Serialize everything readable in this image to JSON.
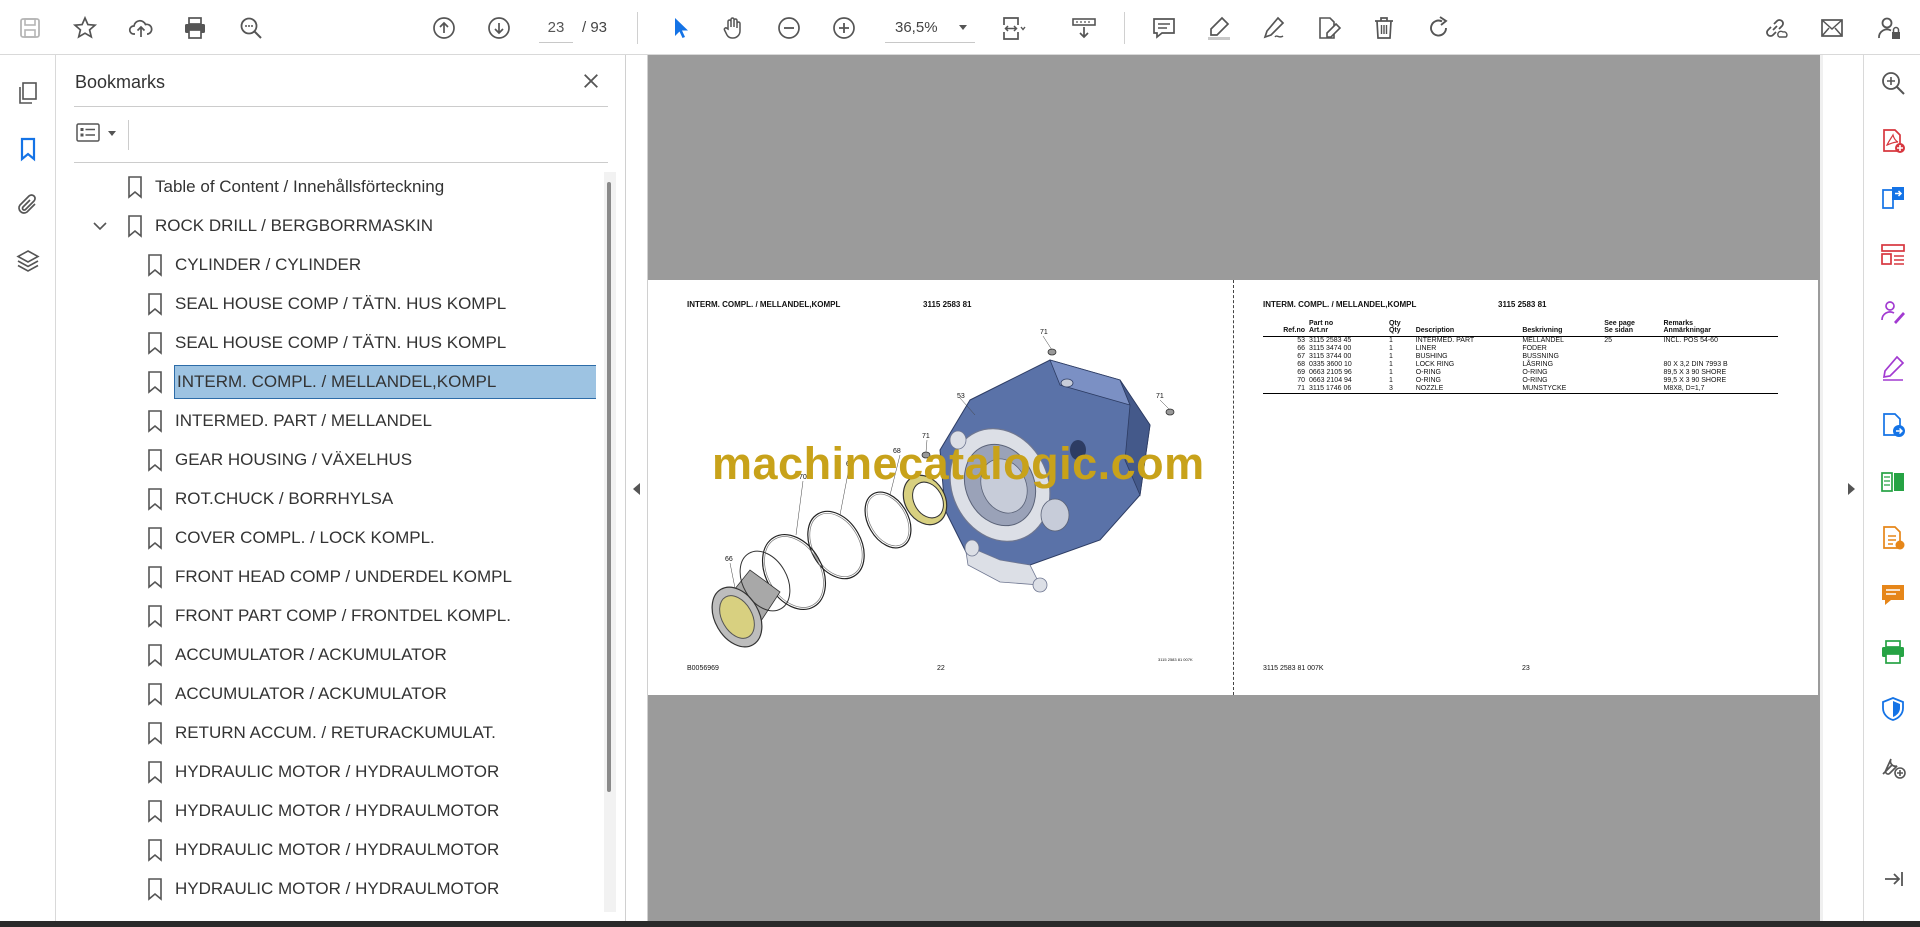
{
  "toolbar": {
    "current_page": "23",
    "total_pages": "/ 93",
    "zoom": "36,5%"
  },
  "bookmarks": {
    "title": "Bookmarks",
    "items": [
      {
        "label": "Table of Content / Innehållsförteckning",
        "level": 0
      },
      {
        "label": "ROCK DRILL / BERGBORRMASKIN",
        "level": 0,
        "expanded": true
      },
      {
        "label": "CYLINDER / CYLINDER",
        "level": 1
      },
      {
        "label": "SEAL HOUSE COMP  / TÄTN. HUS KOMPL",
        "level": 1
      },
      {
        "label": "SEAL HOUSE COMP  / TÄTN. HUS KOMPL",
        "level": 1
      },
      {
        "label": "INTERM. COMPL. / MELLANDEL,KOMPL",
        "level": 1,
        "selected": true
      },
      {
        "label": "INTERMED. PART / MELLANDEL",
        "level": 1
      },
      {
        "label": "GEAR HOUSING / VÄXELHUS",
        "level": 1
      },
      {
        "label": "ROT.CHUCK / BORRHYLSA",
        "level": 1
      },
      {
        "label": "COVER COMPL. / LOCK KOMPL.",
        "level": 1
      },
      {
        "label": "FRONT HEAD COMP  / UNDERDEL KOMPL",
        "level": 1
      },
      {
        "label": "FRONT PART COMP  / FRONTDEL KOMPL.",
        "level": 1
      },
      {
        "label": "ACCUMULATOR / ACKUMULATOR",
        "level": 1
      },
      {
        "label": "ACCUMULATOR / ACKUMULATOR",
        "level": 1
      },
      {
        "label": "RETURN ACCUM. / RETURACKUMULAT.",
        "level": 1
      },
      {
        "label": "HYDRAULIC MOTOR  / HYDRAULMOTOR",
        "level": 1
      },
      {
        "label": "HYDRAULIC MOTOR  / HYDRAULMOTOR",
        "level": 1
      },
      {
        "label": "HYDRAULIC MOTOR  / HYDRAULMOTOR",
        "level": 1
      },
      {
        "label": "HYDRAULIC MOTOR  / HYDRAULMOTOR",
        "level": 1
      }
    ]
  },
  "document": {
    "left_page": {
      "header_title": "INTERM. COMPL. / MELLANDEL,KOMPL",
      "header_partno": "3115 2583 81",
      "footer_left": "B0056969",
      "footer_page": "22",
      "footer_small": "3115 2583 81 007K",
      "callouts": [
        "71",
        "53",
        "71",
        "71",
        "69",
        "68",
        "70",
        "66"
      ]
    },
    "right_page": {
      "header_title": "INTERM. COMPL. / MELLANDEL,KOMPL",
      "header_partno": "3115 2583 81",
      "footer_left": "3115 2583 81 007K",
      "footer_page": "23",
      "columns": [
        "Ref.no",
        "Part no\nArt.nr",
        "Qty\nQty",
        "Description",
        "Beskrivning",
        "See page\nSe sidan",
        "Remarks\nAnmärkningar"
      ],
      "rows": [
        [
          "53",
          "3115 2583 45",
          "1",
          "INTERMED. PART",
          "MELLANDEL",
          "25",
          "INCL. POS 54-60"
        ],
        [
          "66",
          "3115 3474 00",
          "1",
          "LINER",
          "FODER",
          "",
          ""
        ],
        [
          "67",
          "3115 3744 00",
          "1",
          "BUSHING",
          "BUSSNING",
          "",
          ""
        ],
        [
          "68",
          "0335 3600 10",
          "1",
          "LOCK RING",
          "LÅSRING",
          "",
          "80 X 3,2 DIN 7993 B"
        ],
        [
          "69",
          "0663 2105 96",
          "1",
          "O-RING",
          "O-RING",
          "",
          "89,5 X 3 90 SHORE"
        ],
        [
          "70",
          "0663 2104 94",
          "1",
          "O-RING",
          "O-RING",
          "",
          "99,5 X 3 90 SHORE"
        ],
        [
          "71",
          "3115 1746 06",
          "3",
          "NOZZLE",
          "MUNSTYCKE",
          "",
          "M8X8, D=1,7"
        ]
      ]
    },
    "watermark": "machinecatalogic.com"
  },
  "colors": {
    "selection": "#9dc3e2",
    "doc_background": "#9b9b9b",
    "part_blue": "#5a72a8",
    "watermark": "#c8a21a"
  }
}
